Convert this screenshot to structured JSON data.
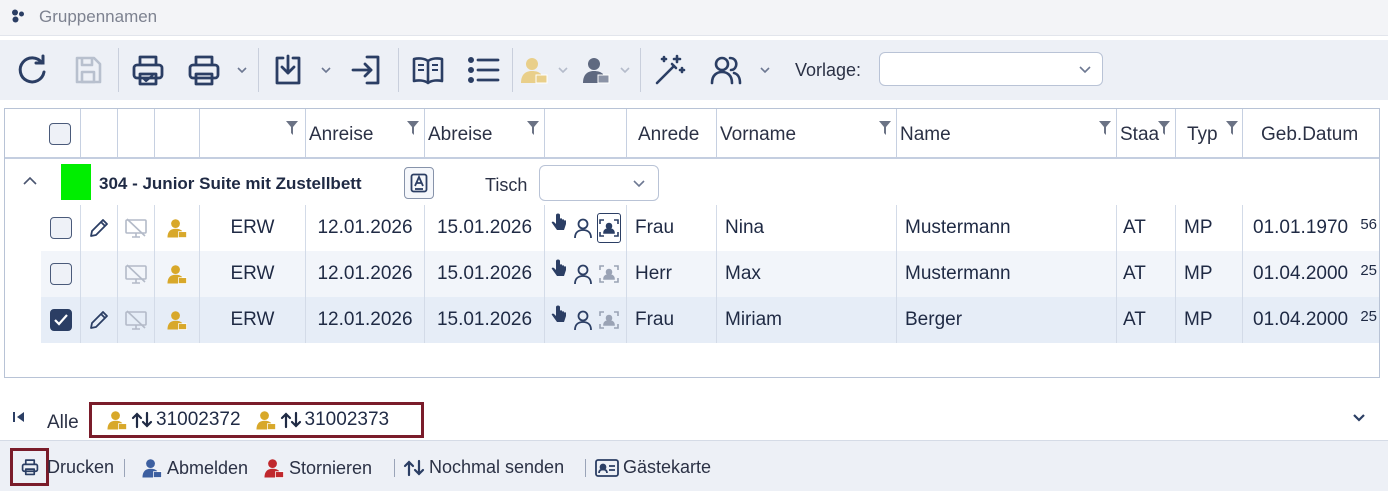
{
  "window": {
    "title": "Gruppennamen"
  },
  "toolbar": {
    "vorlage_label": "Vorlage:",
    "vorlage_value": "",
    "buttons": [
      "refresh-icon",
      "save-icon",
      "print-check-icon",
      "print-icon",
      "export-icon",
      "login-icon",
      "book-icon",
      "list-icon",
      "guest-icon",
      "guest-checkin-icon",
      "magic-wand-icon",
      "users-icon"
    ]
  },
  "grid": {
    "columns": {
      "anreise": "Anreise",
      "abreise": "Abreise",
      "anrede": "Anrede",
      "vorname": "Vorname",
      "name": "Name",
      "staat": "Staa",
      "typ": "Typ",
      "gebdatum": "Geb.Datum"
    },
    "group": {
      "title": "304  -  Junior Suite mit Zustellbett",
      "color": "#00ee00",
      "tisch_label": "Tisch",
      "tisch_value": ""
    },
    "rows": [
      {
        "checked": false,
        "editable": true,
        "category": "ERW",
        "anreise": "12.01.2026",
        "abreise": "15.01.2026",
        "anrede": "Frau",
        "vorname": "Nina",
        "name": "Mustermann",
        "staat": "AT",
        "typ": "MP",
        "gebdatum": "01.01.1970",
        "age": "56"
      },
      {
        "checked": false,
        "editable": false,
        "category": "ERW",
        "anreise": "12.01.2026",
        "abreise": "15.01.2026",
        "anrede": "Herr",
        "vorname": "Max",
        "name": "Mustermann",
        "staat": "AT",
        "typ": "MP",
        "gebdatum": "01.04.2000",
        "age": "25"
      },
      {
        "checked": true,
        "editable": true,
        "category": "ERW",
        "anreise": "12.01.2026",
        "abreise": "15.01.2026",
        "anrede": "Frau",
        "vorname": "Miriam",
        "name": "Berger",
        "staat": "AT",
        "typ": "MP",
        "gebdatum": "01.04.2000",
        "age": "25"
      }
    ]
  },
  "tabs": {
    "all_label": "Alle",
    "items": [
      {
        "number": "31002372"
      },
      {
        "number": "31002373"
      }
    ]
  },
  "actions": {
    "drucken": "Drucken",
    "abmelden": "Abmelden",
    "stornieren": "Stornieren",
    "nochmal_senden": "Nochmal senden",
    "gaestekarte": "Gästekarte"
  },
  "colors": {
    "accent": "#2b3e64",
    "guest_icon": "#d8a82a",
    "storno_icon": "#c0282d",
    "abmelden_icon": "#3d5fa0",
    "highlight_box": "#7a1c2a"
  }
}
